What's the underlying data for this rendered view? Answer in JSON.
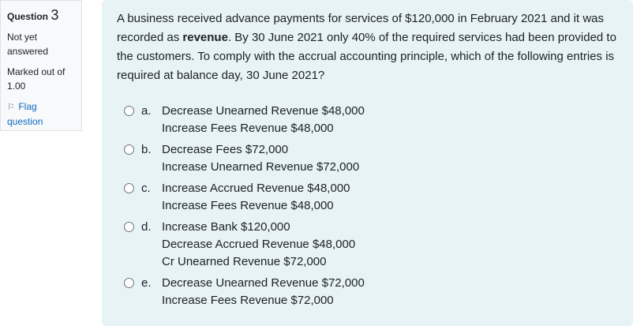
{
  "info": {
    "question_label": "Question",
    "question_number": "3",
    "state_line1": "Not yet",
    "state_line2": "answered",
    "grade_line1": "Marked out of",
    "grade_line2": "1.00",
    "flag_line1": "Flag",
    "flag_line2": "question"
  },
  "question": {
    "text_part1": "A business received advance payments for services of $120,000 in February 2021 and it was recorded as ",
    "text_bold": "revenue",
    "text_part2": ". By 30 June 2021 only 40% of the required services had been provided to the customers. To comply with the accrual accounting principle, which of the following entries is required at balance day, 30 June 2021?"
  },
  "answers": [
    {
      "letter": "a.",
      "line1": "Decrease Unearned Revenue $48,000",
      "line2": "Increase Fees Revenue $48,000"
    },
    {
      "letter": "b.",
      "line1": "Decrease Fees $72,000",
      "line2": "Increase Unearned Revenue $72,000"
    },
    {
      "letter": "c.",
      "line1": "Increase Accrued Revenue $48,000",
      "line2": "Increase Fees Revenue $48,000"
    },
    {
      "letter": "d.",
      "line1": "Increase Bank $120,000",
      "line2": "Decrease Accrued Revenue $48,000",
      "line3": "Cr Unearned Revenue $72,000"
    },
    {
      "letter": "e.",
      "line1": "Decrease Unearned Revenue $72,000",
      "line2": "Increase Fees Revenue $72,000"
    }
  ],
  "colors": {
    "info_bg": "#f8f9fa",
    "content_bg": "#e7f3f5",
    "link": "#0f6cbf"
  }
}
